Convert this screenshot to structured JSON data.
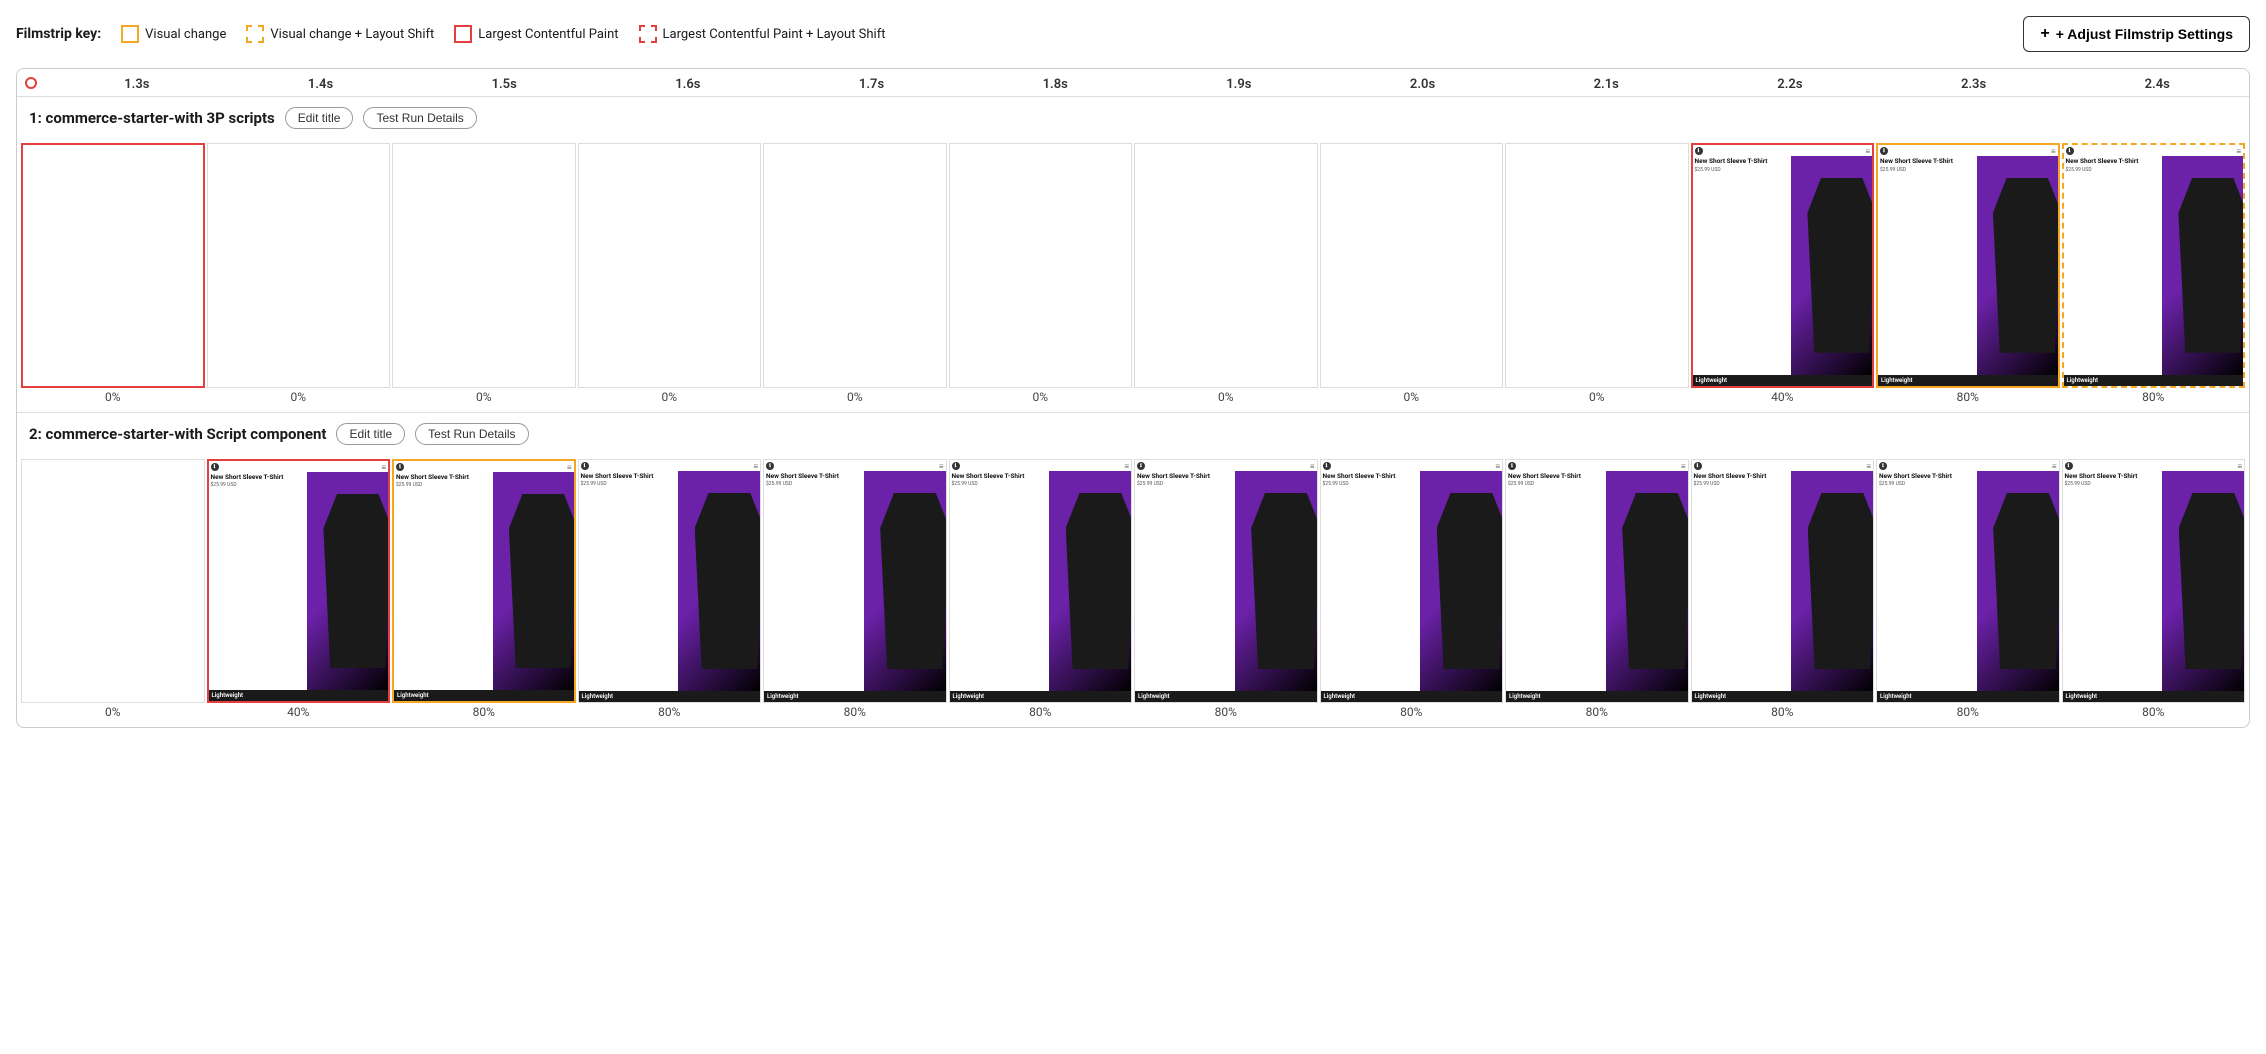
{
  "topBar": {
    "filmstripKeyLabel": "Filmstrip key:",
    "keyItems": [
      {
        "id": "visual-change",
        "label": "Visual change",
        "borderStyle": "solid-yellow"
      },
      {
        "id": "visual-change-layout",
        "label": "Visual change + Layout Shift",
        "borderStyle": "dashed-yellow"
      },
      {
        "id": "lcp",
        "label": "Largest Contentful Paint",
        "borderStyle": "solid-red"
      },
      {
        "id": "lcp-layout",
        "label": "Largest Contentful Paint + Layout Shift",
        "borderStyle": "dashed-red"
      }
    ],
    "adjustButton": "+ Adjust Filmstrip Settings"
  },
  "timeline": {
    "ticks": [
      "1.3s",
      "1.4s",
      "1.5s",
      "1.6s",
      "1.7s",
      "1.8s",
      "1.9s",
      "2.0s",
      "2.1s",
      "2.2s",
      "2.3s",
      "2.4s"
    ]
  },
  "rows": [
    {
      "id": "row1",
      "title": "1: commerce-starter-with 3P scripts",
      "editTitleLabel": "Edit title",
      "testRunLabel": "Test Run Details",
      "frames": [
        {
          "id": "f1-1",
          "border": "red-solid",
          "empty": true,
          "percent": "0%"
        },
        {
          "id": "f1-2",
          "border": "none",
          "empty": true,
          "percent": "0%"
        },
        {
          "id": "f1-3",
          "border": "none",
          "empty": true,
          "percent": "0%"
        },
        {
          "id": "f1-4",
          "border": "none",
          "empty": true,
          "percent": "0%"
        },
        {
          "id": "f1-5",
          "border": "none",
          "empty": true,
          "percent": "0%"
        },
        {
          "id": "f1-6",
          "border": "none",
          "empty": true,
          "percent": "0%"
        },
        {
          "id": "f1-7",
          "border": "none",
          "empty": true,
          "percent": "0%"
        },
        {
          "id": "f1-8",
          "border": "none",
          "empty": true,
          "percent": "0%"
        },
        {
          "id": "f1-9",
          "border": "none",
          "empty": true,
          "percent": "0%"
        },
        {
          "id": "f1-10",
          "border": "red-solid",
          "empty": false,
          "percent": "40%",
          "product": {
            "name": "New Short Sleeve T-Shirt",
            "price": "$25.99 USD",
            "bottom": "Lightweight"
          }
        },
        {
          "id": "f1-11",
          "border": "yellow-solid",
          "empty": false,
          "percent": "80%",
          "product": {
            "name": "New Short Sleeve T-Shirt",
            "price": "$25.99 USD",
            "bottom": "Lightweight"
          }
        },
        {
          "id": "f1-12",
          "border": "yellow-dashed",
          "empty": false,
          "percent": "80%",
          "product": {
            "name": "New Short Sleeve T-Shirt",
            "price": "$25.99 USD",
            "bottom": "Lightweight"
          }
        }
      ]
    },
    {
      "id": "row2",
      "title": "2: commerce-starter-with Script component",
      "editTitleLabel": "Edit title",
      "testRunLabel": "Test Run Details",
      "frames": [
        {
          "id": "f2-1",
          "border": "none",
          "empty": true,
          "percent": "0%"
        },
        {
          "id": "f2-2",
          "border": "red-solid",
          "empty": false,
          "percent": "40%",
          "product": {
            "name": "New Short Sleeve T-Shirt",
            "price": "$25.99 USD",
            "bottom": "Lightweight"
          }
        },
        {
          "id": "f2-3",
          "border": "yellow-solid",
          "empty": false,
          "percent": "80%",
          "product": {
            "name": "New Short Sleeve T-Shirt",
            "price": "$25.99 USD",
            "bottom": "Lightweight"
          }
        },
        {
          "id": "f2-4",
          "border": "none",
          "empty": false,
          "percent": "80%",
          "product": {
            "name": "New Short Sleeve T-Shirt",
            "price": "$25.99 USD",
            "bottom": "Lightweight"
          }
        },
        {
          "id": "f2-5",
          "border": "none",
          "empty": false,
          "percent": "80%",
          "product": {
            "name": "New Short Sleeve T-Shirt",
            "price": "$25.99 USD",
            "bottom": "Lightweight"
          }
        },
        {
          "id": "f2-6",
          "border": "none",
          "empty": false,
          "percent": "80%",
          "product": {
            "name": "New Short Sleeve T-Shirt",
            "price": "$25.99 USD",
            "bottom": "Lightweight"
          }
        },
        {
          "id": "f2-7",
          "border": "none",
          "empty": false,
          "percent": "80%",
          "product": {
            "name": "New Short Sleeve T-Shirt",
            "price": "$25.99 USD",
            "bottom": "Lightweight"
          }
        },
        {
          "id": "f2-8",
          "border": "none",
          "empty": false,
          "percent": "80%",
          "product": {
            "name": "New Short Sleeve T-Shirt",
            "price": "$25.99 USD",
            "bottom": "Lightweight"
          }
        },
        {
          "id": "f2-9",
          "border": "none",
          "empty": false,
          "percent": "80%",
          "product": {
            "name": "New Short Sleeve T-Shirt",
            "price": "$25.99 USD",
            "bottom": "Lightweight"
          }
        },
        {
          "id": "f2-10",
          "border": "none",
          "empty": false,
          "percent": "80%",
          "product": {
            "name": "New Short Sleeve T-Shirt",
            "price": "$25.99 USD",
            "bottom": "Lightweight"
          }
        },
        {
          "id": "f2-11",
          "border": "none",
          "empty": false,
          "percent": "80%",
          "product": {
            "name": "New Short Sleeve T-Shirt",
            "price": "$25.99 USD",
            "bottom": "Lightweight"
          }
        },
        {
          "id": "f2-12",
          "border": "none",
          "empty": false,
          "percent": "80%",
          "product": {
            "name": "New Short Sleeve T-Shirt",
            "price": "$25.99 USD",
            "bottom": "Lightweight"
          }
        }
      ]
    }
  ]
}
